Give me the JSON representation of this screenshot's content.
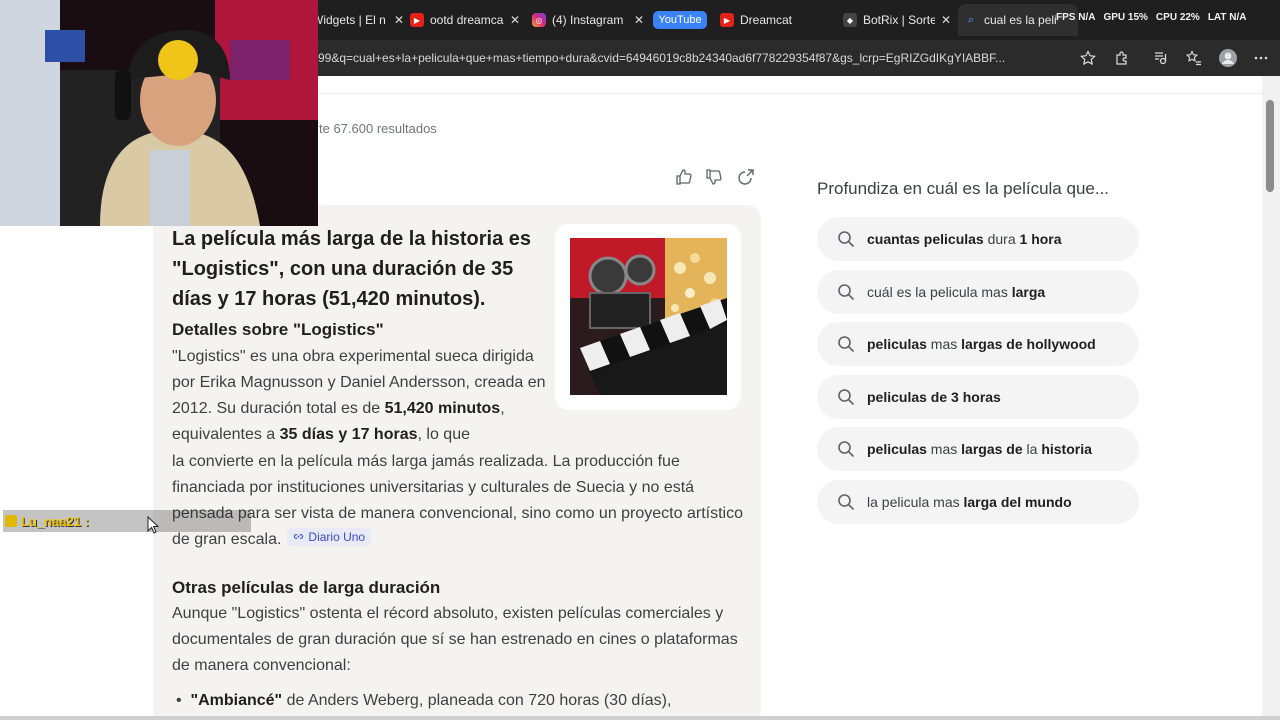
{
  "browser": {
    "tabs": [
      {
        "title": "Widgets | El n"
      },
      {
        "title": "ootd dreamca"
      },
      {
        "title": "(4) Instagram"
      },
      {
        "title": "Dreamcat"
      },
      {
        "title": "BotRix | Sorte"
      },
      {
        "title": "cual es la peli"
      }
    ],
    "tab_group_label": "YouTube",
    "address_bar": "99&q=cual+es+la+pelicula+que+mas+tiempo+dura&cvid=64946019c8b24340ad6f778229354f87&gs_lcrp=EgRIZGdIKgYIABBF...",
    "stats": [
      "FPS N/A",
      "GPU 15%",
      "CPU 22%",
      "LAT N/A"
    ]
  },
  "search": {
    "results_count": "te 67.600 resultados"
  },
  "answer": {
    "headline": "La película más larga de la historia es \"Logistics\", con una duración de 35 días y 17 horas (51,420 minutos).",
    "section1_title": "Detalles sobre \"Logistics\"",
    "para1_a": "\"Logistics\" es una obra experimental sueca dirigida por Erika Magnusson y Daniel Andersson, creada en 2012. Su duración total es de ",
    "para1_b": "51,420 minutos",
    "para1_c": ", equivalentes a ",
    "para1_d": "35 días y 17 horas",
    "para1_e": ", lo que",
    "para1_f": "la convierte en la película más larga jamás realizada. La producción fue financiada por instituciones universitarias y culturales de Suecia y no está pensada para ser vista de manera convencional, sino como un proyecto artístico de gran escala.",
    "source_chip": "Diario Uno",
    "section2_title": "Otras películas de larga duración",
    "para2": "Aunque \"Logistics\" ostenta el récord absoluto, existen películas comerciales y documentales de gran duración que sí se han estrenado en cines o plataformas de manera convencional:",
    "bullet1_bold": "\"Ambiancé\"",
    "bullet1_rest": " de Anders Weberg, planeada con 720 horas (30 días),"
  },
  "sidebar": {
    "heading": "Profundiza en cuál es la película que...",
    "suggestions": [
      {
        "a": "cuantas peliculas",
        "b": " dura ",
        "c": "1 hora"
      },
      {
        "a": "cuál es la pelicula mas ",
        "b": "larga",
        "c": ""
      },
      {
        "a": "peliculas",
        "b": " mas ",
        "c": "largas de hollywood"
      },
      {
        "a": "peliculas de 3 horas",
        "b": "",
        "c": ""
      },
      {
        "a": "peliculas",
        "b": " mas ",
        "c": "largas de",
        "d": " la ",
        "e": "historia"
      },
      {
        "a": "la pelicula mas ",
        "b": "larga del mundo",
        "c": ""
      }
    ]
  },
  "overlay": {
    "chat_user": "Lu_naa21 :"
  }
}
